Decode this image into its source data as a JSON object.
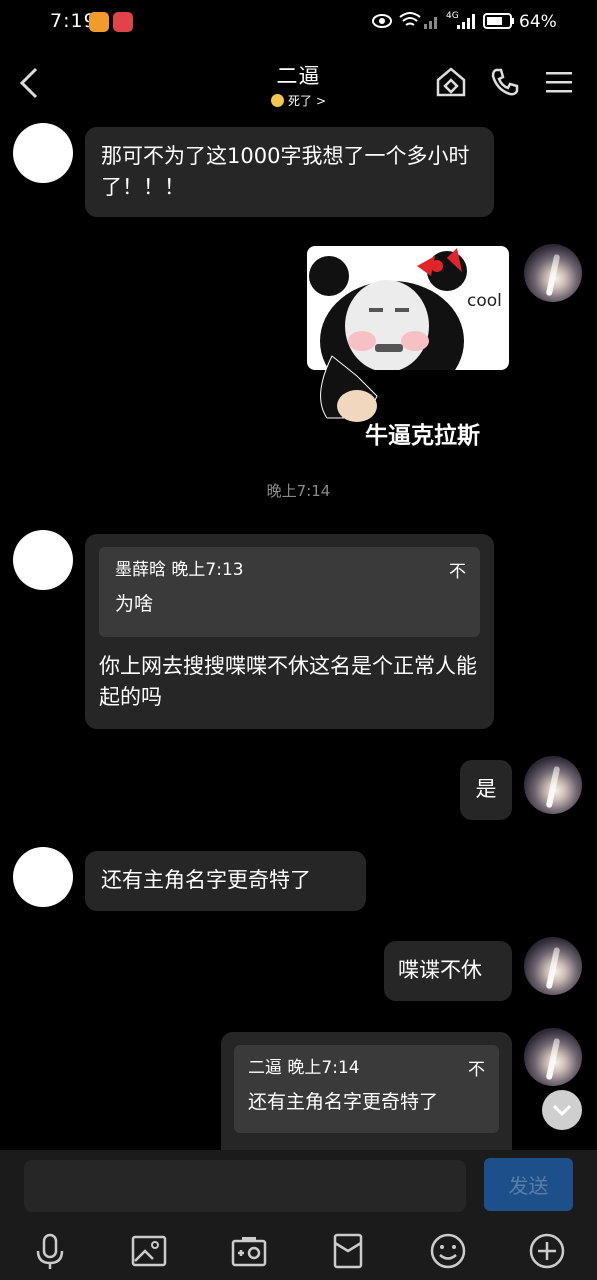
{
  "status_bar": {
    "time": "7:19",
    "network": "4G",
    "battery": "64%"
  },
  "header": {
    "title": "二逼",
    "status": "死了",
    "status_chevron": ">",
    "icons": [
      "back-icon",
      "house-icon",
      "phone-icon",
      "menu-icon"
    ]
  },
  "messages": [
    {
      "side": "left",
      "type": "text",
      "text": "那可不为了这1000字我想了一个多小时了！！！"
    },
    {
      "side": "right",
      "type": "sticker",
      "caption": "牛逼克拉斯",
      "tag": "cool"
    },
    {
      "type": "timestamp",
      "text": "晚上7:14"
    },
    {
      "side": "left",
      "type": "reply",
      "quote_author": "墨薛晗 晚上7:13",
      "quote_text": "为啥",
      "quote_close": "不",
      "text": "你上网去搜搜喋喋不休这名是个正常人能起的吗"
    },
    {
      "side": "right",
      "type": "text",
      "text": "是"
    },
    {
      "side": "left",
      "type": "text",
      "text": "还有主角名字更奇特了"
    },
    {
      "side": "right",
      "type": "text",
      "text": "喋谍不休"
    },
    {
      "side": "right",
      "type": "reply",
      "quote_author": "二逼 晚上7:14",
      "quote_text": "还有主角名字更奇特了",
      "quote_close": "不"
    }
  ],
  "input": {
    "placeholder": "",
    "send_label": "发送"
  },
  "toolbar": [
    "microphone-icon",
    "image-icon",
    "camera-icon",
    "red-packet-icon",
    "emoji-icon",
    "plus-icon"
  ],
  "colors": {
    "background": "#000000",
    "bubble": "#262626",
    "quote": "#3a3a3a",
    "send": "#1d4f8a"
  }
}
